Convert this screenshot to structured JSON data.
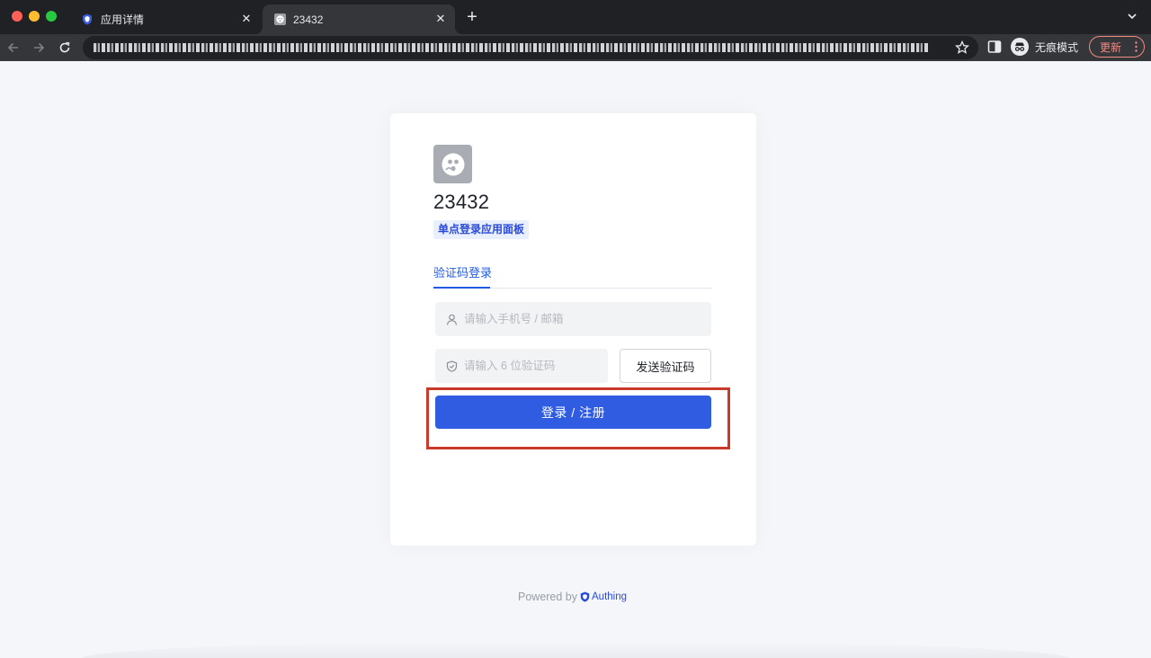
{
  "browser": {
    "tabs": [
      {
        "title": "应用详情",
        "favicon": "shield-icon",
        "active": false
      },
      {
        "title": "23432",
        "favicon": "app-face-icon",
        "active": true
      }
    ],
    "new_tab_symbol": "+",
    "incognito_label": "无痕模式",
    "update_label": "更新"
  },
  "app": {
    "name": "23432",
    "tag": "单点登录应用面板",
    "logo_icon": "face-icon"
  },
  "login": {
    "tab_label": "验证码登录",
    "phone_placeholder": "请输入手机号 / 邮箱",
    "code_placeholder": "请输入 6 位验证码",
    "send_code_label": "发送验证码",
    "submit_label": "登录 / 注册"
  },
  "footer": {
    "powered_by": "Powered by",
    "brand": "Authing"
  },
  "colors": {
    "primary": "#2f5ce0",
    "highlight": "#c93a2c",
    "tag_bg": "#e9effc"
  }
}
